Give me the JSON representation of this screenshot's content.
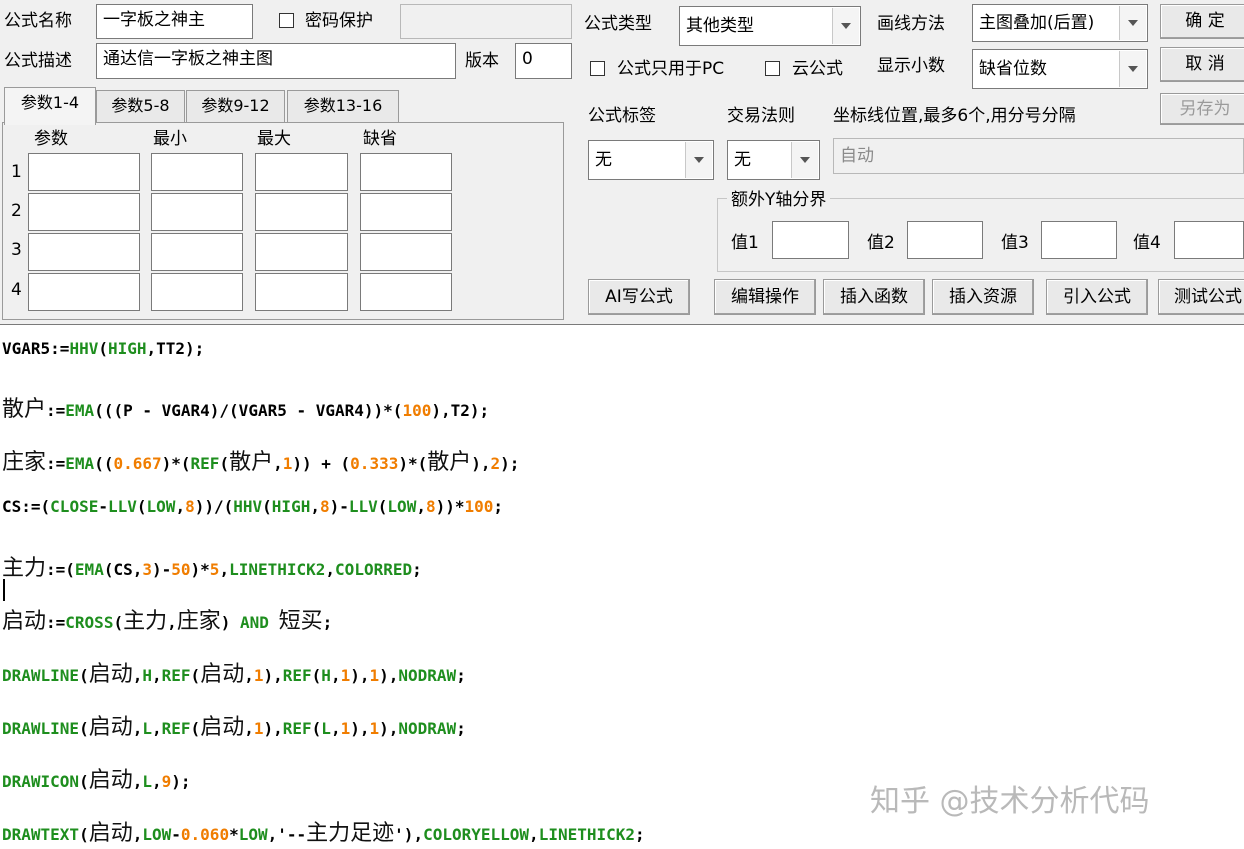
{
  "header": {
    "name_label": "公式名称",
    "name_value": "一字板之神主",
    "password_label": "密码保护",
    "password_value": "",
    "desc_label": "公式描述",
    "desc_value": "通达信一字板之神主图",
    "version_label": "版本",
    "version_value": "0",
    "type_label": "公式类型",
    "type_value": "其他类型",
    "draw_method_label": "画线方法",
    "draw_method_value": "主图叠加(后置)",
    "pc_only_label": "公式只用于PC",
    "cloud_label": "云公式",
    "decimals_label": "显示小数",
    "decimals_value": "缺省位数",
    "confirm_button": "确 定",
    "cancel_button": "取 消",
    "save_as_button": "另存为"
  },
  "param_tabs": [
    "参数1-4",
    "参数5-8",
    "参数9-12",
    "参数13-16"
  ],
  "param_table": {
    "headers": [
      "参数",
      "最小",
      "最大",
      "缺省"
    ],
    "rows": [
      "1",
      "2",
      "3",
      "4"
    ]
  },
  "right_panel": {
    "tag_label": "公式标签",
    "tag_value": "无",
    "trade_rule_label": "交易法则",
    "trade_rule_value": "无",
    "axis_label": "坐标线位置,最多6个,用分号分隔",
    "axis_value": "自动",
    "y_axis_group_title": "额外Y轴分界",
    "y_values": [
      "值1",
      "值2",
      "值3",
      "值4"
    ]
  },
  "toolbar": {
    "ai_button": "AI写公式",
    "edit_button": "编辑操作",
    "insert_func_button": "插入函数",
    "insert_resource_button": "插入资源",
    "import_button": "引入公式",
    "test_button": "测试公式"
  },
  "code_lines": [
    [
      [
        "d",
        "VGAR5:="
      ],
      [
        "f",
        "HHV"
      ],
      [
        "d",
        "("
      ],
      [
        "f",
        "HIGH"
      ],
      [
        "d",
        ",TT2);"
      ]
    ],
    [
      [
        "c",
        "散户"
      ],
      [
        "d",
        ":="
      ],
      [
        "f",
        "EMA"
      ],
      [
        "d",
        "(((P - VGAR4)/(VGAR5 - VGAR4))*("
      ],
      [
        "n",
        "100"
      ],
      [
        "d",
        "),T2);"
      ]
    ],
    [
      [
        "c",
        "庄家"
      ],
      [
        "d",
        ":="
      ],
      [
        "f",
        "EMA"
      ],
      [
        "d",
        "(("
      ],
      [
        "n",
        "0.667"
      ],
      [
        "d",
        ")*("
      ],
      [
        "f",
        "REF"
      ],
      [
        "d",
        "("
      ],
      [
        "c",
        "散户"
      ],
      [
        "d",
        ","
      ],
      [
        "n",
        "1"
      ],
      [
        "d",
        ")) + ("
      ],
      [
        "n",
        "0.333"
      ],
      [
        "d",
        ")*("
      ],
      [
        "c",
        "散户"
      ],
      [
        "d",
        "),"
      ],
      [
        "n",
        "2"
      ],
      [
        "d",
        ");"
      ]
    ],
    [
      [
        "d",
        "CS:=("
      ],
      [
        "f",
        "CLOSE"
      ],
      [
        "d",
        "-"
      ],
      [
        "f",
        "LLV"
      ],
      [
        "d",
        "("
      ],
      [
        "f",
        "LOW"
      ],
      [
        "d",
        ","
      ],
      [
        "n",
        "8"
      ],
      [
        "d",
        "))/("
      ],
      [
        "f",
        "HHV"
      ],
      [
        "d",
        "("
      ],
      [
        "f",
        "HIGH"
      ],
      [
        "d",
        ","
      ],
      [
        "n",
        "8"
      ],
      [
        "d",
        ")-"
      ],
      [
        "f",
        "LLV"
      ],
      [
        "d",
        "("
      ],
      [
        "f",
        "LOW"
      ],
      [
        "d",
        ","
      ],
      [
        "n",
        "8"
      ],
      [
        "d",
        "))*"
      ],
      [
        "n",
        "100"
      ],
      [
        "d",
        ";"
      ]
    ],
    [
      [
        "c",
        "主力"
      ],
      [
        "d",
        ":=("
      ],
      [
        "f",
        "EMA"
      ],
      [
        "d",
        "(CS,"
      ],
      [
        "n",
        "3"
      ],
      [
        "d",
        ")-"
      ],
      [
        "n",
        "50"
      ],
      [
        "d",
        ")*"
      ],
      [
        "n",
        "5"
      ],
      [
        "d",
        ","
      ],
      [
        "f",
        "LINETHICK2"
      ],
      [
        "d",
        ","
      ],
      [
        "f",
        "COLORRED"
      ],
      [
        "d",
        ";"
      ]
    ],
    [
      [
        "c",
        "启动"
      ],
      [
        "d",
        ":="
      ],
      [
        "f",
        "CROSS"
      ],
      [
        "d",
        "("
      ],
      [
        "c",
        "主力"
      ],
      [
        "d",
        ","
      ],
      [
        "c",
        "庄家"
      ],
      [
        "d",
        ") "
      ],
      [
        "f",
        "AND"
      ],
      [
        "d",
        " "
      ],
      [
        "c",
        "短买"
      ],
      [
        "d",
        ";"
      ]
    ],
    [
      [
        "f",
        "DRAWLINE"
      ],
      [
        "d",
        "("
      ],
      [
        "c",
        "启动"
      ],
      [
        "d",
        ","
      ],
      [
        "f",
        "H"
      ],
      [
        "d",
        ","
      ],
      [
        "f",
        "REF"
      ],
      [
        "d",
        "("
      ],
      [
        "c",
        "启动"
      ],
      [
        "d",
        ","
      ],
      [
        "n",
        "1"
      ],
      [
        "d",
        "),"
      ],
      [
        "f",
        "REF"
      ],
      [
        "d",
        "("
      ],
      [
        "f",
        "H"
      ],
      [
        "d",
        ","
      ],
      [
        "n",
        "1"
      ],
      [
        "d",
        "),"
      ],
      [
        "n",
        "1"
      ],
      [
        "d",
        "),"
      ],
      [
        "f",
        "NODRAW"
      ],
      [
        "d",
        ";"
      ]
    ],
    [
      [
        "f",
        "DRAWLINE"
      ],
      [
        "d",
        "("
      ],
      [
        "c",
        "启动"
      ],
      [
        "d",
        ","
      ],
      [
        "f",
        "L"
      ],
      [
        "d",
        ","
      ],
      [
        "f",
        "REF"
      ],
      [
        "d",
        "("
      ],
      [
        "c",
        "启动"
      ],
      [
        "d",
        ","
      ],
      [
        "n",
        "1"
      ],
      [
        "d",
        "),"
      ],
      [
        "f",
        "REF"
      ],
      [
        "d",
        "("
      ],
      [
        "f",
        "L"
      ],
      [
        "d",
        ","
      ],
      [
        "n",
        "1"
      ],
      [
        "d",
        "),"
      ],
      [
        "n",
        "1"
      ],
      [
        "d",
        "),"
      ],
      [
        "f",
        "NODRAW"
      ],
      [
        "d",
        ";"
      ]
    ],
    [
      [
        "f",
        "DRAWICON"
      ],
      [
        "d",
        "("
      ],
      [
        "c",
        "启动"
      ],
      [
        "d",
        ","
      ],
      [
        "f",
        "L"
      ],
      [
        "d",
        ","
      ],
      [
        "n",
        "9"
      ],
      [
        "d",
        ");"
      ]
    ],
    [
      [
        "f",
        "DRAWTEXT"
      ],
      [
        "d",
        "("
      ],
      [
        "c",
        "启动"
      ],
      [
        "d",
        ","
      ],
      [
        "f",
        "LOW"
      ],
      [
        "d",
        "-"
      ],
      [
        "n",
        "0.060"
      ],
      [
        "d",
        "*"
      ],
      [
        "f",
        "LOW"
      ],
      [
        "d",
        ",'--"
      ],
      [
        "c",
        "主力足迹"
      ],
      [
        "d",
        "'),"
      ],
      [
        "f",
        "COLORYELLOW"
      ],
      [
        "d",
        ","
      ],
      [
        "f",
        "LINETHICK2"
      ],
      [
        "d",
        ";"
      ]
    ]
  ],
  "watermark": "知乎 @技术分析代码"
}
